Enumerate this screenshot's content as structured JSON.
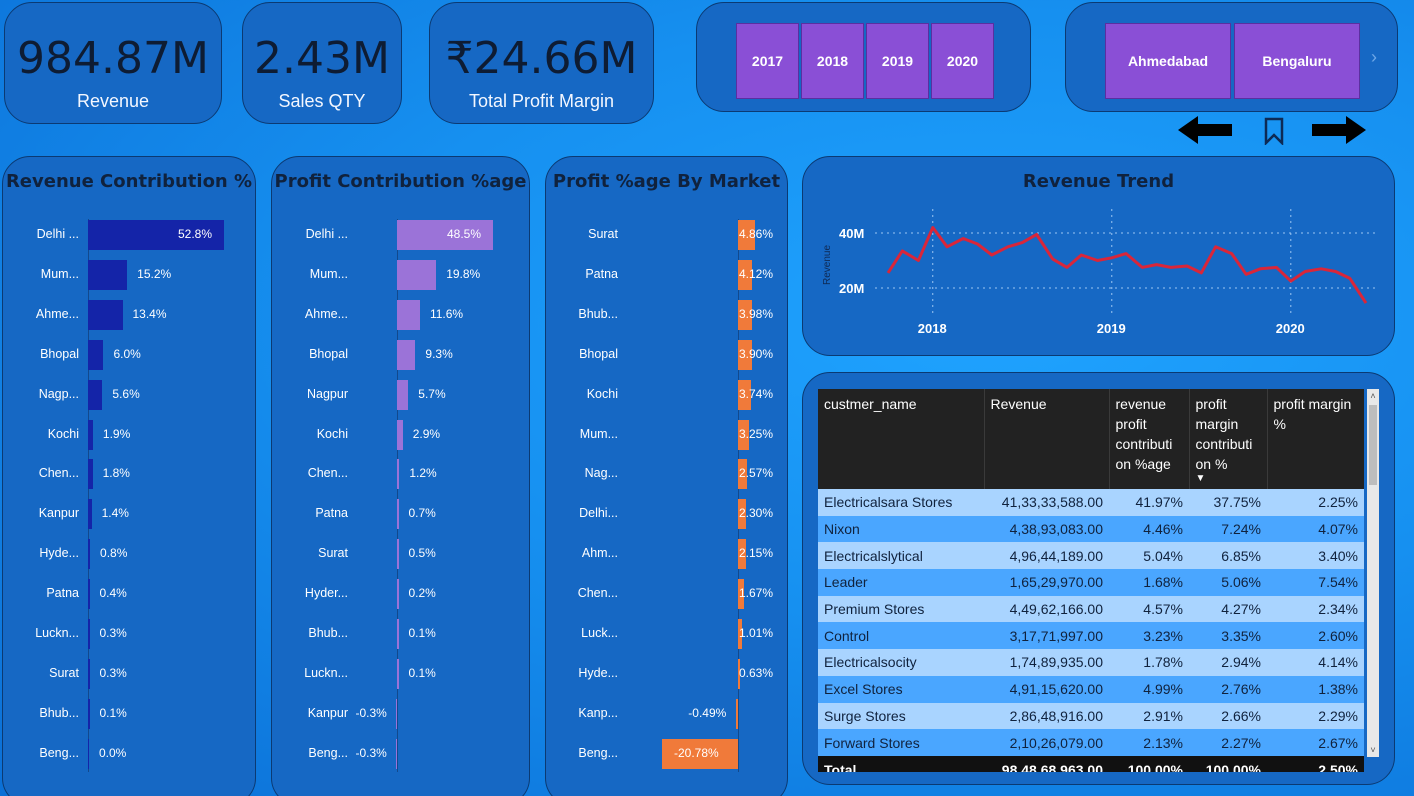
{
  "kpis": [
    {
      "value": "984.87M",
      "label": "Revenue"
    },
    {
      "value": "2.43M",
      "label": "Sales QTY"
    },
    {
      "value": "₹24.66M",
      "label": "Total Profit Margin"
    }
  ],
  "year_slicer": [
    "2017",
    "2018",
    "2019",
    "2020"
  ],
  "city_slicer": [
    "Ahmedabad",
    "Bengaluru"
  ],
  "colors": {
    "revenue_bar": "#1424a8",
    "profit_bar": "#9b73d8",
    "market_bar": "#f07a3a",
    "trend_line": "#d9263a"
  },
  "chart_data": [
    {
      "type": "bar",
      "title": "Revenue Contribution %",
      "categories": [
        "Delhi ...",
        "Mum...",
        "Ahme...",
        "Bhopal",
        "Nagp...",
        "Kochi",
        "Chen...",
        "Kanpur",
        "Hyde...",
        "Patna",
        "Luckn...",
        "Surat",
        "Bhub...",
        "Beng..."
      ],
      "values": [
        52.8,
        15.2,
        13.4,
        6.0,
        5.6,
        1.9,
        1.8,
        1.4,
        0.8,
        0.4,
        0.3,
        0.3,
        0.1,
        0.0
      ],
      "labels": [
        "52.8%",
        "15.2%",
        "13.4%",
        "6.0%",
        "5.6%",
        "1.9%",
        "1.8%",
        "1.4%",
        "0.8%",
        "0.4%",
        "0.3%",
        "0.3%",
        "0.1%",
        "0.0%"
      ]
    },
    {
      "type": "bar",
      "title": "Profit Contribution %age",
      "categories": [
        "Delhi ...",
        "Mum...",
        "Ahme...",
        "Bhopal",
        "Nagpur",
        "Kochi",
        "Chen...",
        "Patna",
        "Surat",
        "Hyder...",
        "Bhub...",
        "Luckn...",
        "Kanpur",
        "Beng..."
      ],
      "values": [
        48.5,
        19.8,
        11.6,
        9.3,
        5.7,
        2.9,
        1.2,
        0.7,
        0.5,
        0.2,
        0.1,
        0.1,
        -0.3,
        -0.3
      ],
      "labels": [
        "48.5%",
        "19.8%",
        "11.6%",
        "9.3%",
        "5.7%",
        "2.9%",
        "1.2%",
        "0.7%",
        "0.5%",
        "0.2%",
        "0.1%",
        "0.1%",
        "-0.3%",
        "-0.3%"
      ]
    },
    {
      "type": "bar",
      "title": "Profit %age By Market",
      "categories": [
        "Surat",
        "Patna",
        "Bhub...",
        "Bhopal",
        "Kochi",
        "Mum...",
        "Nag...",
        "Delhi...",
        "Ahm...",
        "Chen...",
        "Luck...",
        "Hyde...",
        "Kanp...",
        "Beng..."
      ],
      "values": [
        4.86,
        4.12,
        3.98,
        3.9,
        3.74,
        3.25,
        2.57,
        2.3,
        2.15,
        1.67,
        1.01,
        0.63,
        -0.49,
        -20.78
      ],
      "labels": [
        "4.86%",
        "4.12%",
        "3.98%",
        "3.90%",
        "3.74%",
        "3.25%",
        "2.57%",
        "2.30%",
        "2.15%",
        "1.67%",
        "1.01%",
        "0.63%",
        "-0.49%",
        "-20.78%"
      ]
    },
    {
      "type": "line",
      "title": "Revenue Trend",
      "ylabel": "Revenue",
      "x_ticks": [
        "2018",
        "2019",
        "2020"
      ],
      "y_ticks": [
        "20M",
        "40M"
      ],
      "ylim": [
        0,
        50
      ],
      "x": [
        2017.75,
        2017.83,
        2017.92,
        2018.0,
        2018.08,
        2018.17,
        2018.25,
        2018.33,
        2018.42,
        2018.5,
        2018.58,
        2018.67,
        2018.75,
        2018.83,
        2018.92,
        2019.0,
        2019.08,
        2019.17,
        2019.25,
        2019.33,
        2019.42,
        2019.5,
        2019.58,
        2019.67,
        2019.75,
        2019.83,
        2019.92,
        2020.0,
        2020.08,
        2020.17,
        2020.25,
        2020.33,
        2020.42
      ],
      "values": [
        25.5,
        33.5,
        30.0,
        42.0,
        35.0,
        38.0,
        36.0,
        32.0,
        35.0,
        36.5,
        39.5,
        30.5,
        27.5,
        32.0,
        30.0,
        31.0,
        32.5,
        27.5,
        28.5,
        27.5,
        28.0,
        25.5,
        35.0,
        32.5,
        25.0,
        27.0,
        27.5,
        22.5,
        26.0,
        27.0,
        26.0,
        23.5,
        14.5
      ]
    }
  ],
  "table": {
    "columns": [
      "custmer_name",
      "Revenue",
      "revenue profit contributi on %age",
      "profit margin contributi on %",
      "profit margin %"
    ],
    "rows": [
      [
        "Electricalsara Stores",
        "41,33,33,588.00",
        "41.97%",
        "37.75%",
        "2.25%"
      ],
      [
        "Nixon",
        "4,38,93,083.00",
        "4.46%",
        "7.24%",
        "4.07%"
      ],
      [
        "Electricalslytical",
        "4,96,44,189.00",
        "5.04%",
        "6.85%",
        "3.40%"
      ],
      [
        "Leader",
        "1,65,29,970.00",
        "1.68%",
        "5.06%",
        "7.54%"
      ],
      [
        "Premium Stores",
        "4,49,62,166.00",
        "4.57%",
        "4.27%",
        "2.34%"
      ],
      [
        "Control",
        "3,17,71,997.00",
        "3.23%",
        "3.35%",
        "2.60%"
      ],
      [
        "Electricalsocity",
        "1,74,89,935.00",
        "1.78%",
        "2.94%",
        "4.14%"
      ],
      [
        "Excel Stores",
        "4,91,15,620.00",
        "4.99%",
        "2.76%",
        "1.38%"
      ],
      [
        "Surge Stores",
        "2,86,48,916.00",
        "2.91%",
        "2.66%",
        "2.29%"
      ],
      [
        "Forward Stores",
        "2,10,26,079.00",
        "2.13%",
        "2.27%",
        "2.67%"
      ]
    ],
    "total": [
      "Total",
      "98,48,68,963.00",
      "100.00%",
      "100.00%",
      "2.50%"
    ]
  }
}
